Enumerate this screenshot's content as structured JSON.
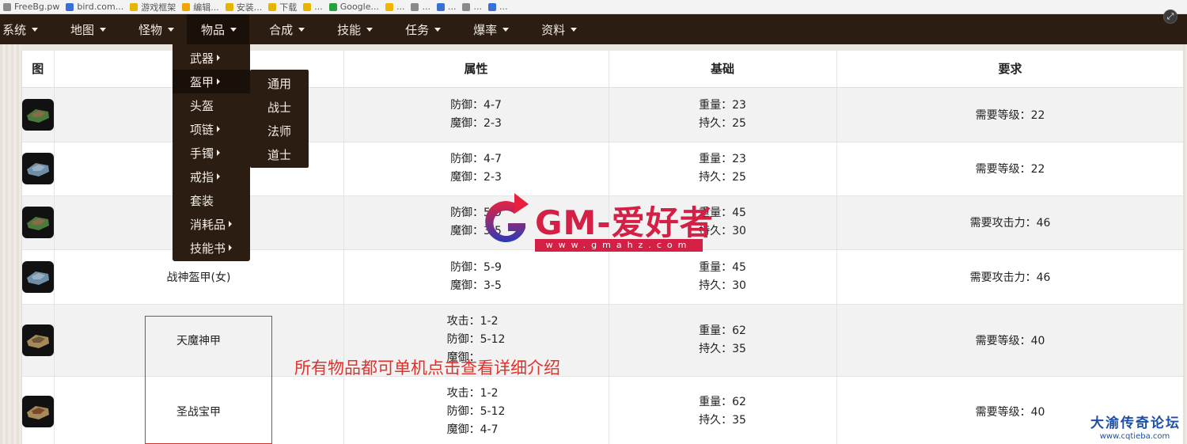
{
  "browser": {
    "bookmarks": [
      {
        "label": "FreeBg.pw",
        "color": "#8a8a8a"
      },
      {
        "label": "bird.com...",
        "color": "#3b6fd8"
      },
      {
        "label": "游戏框架",
        "color": "#e7b400"
      },
      {
        "label": "编辑...",
        "color": "#f0a500"
      },
      {
        "label": "安装...",
        "color": "#e7b400"
      },
      {
        "label": "下载",
        "color": "#e7b400"
      },
      {
        "label": "...",
        "color": "#e7b400"
      },
      {
        "label": "Google...",
        "color": "#22a33b"
      },
      {
        "label": "...",
        "color": "#f2b400"
      },
      {
        "label": "...",
        "color": "#8a8a8a"
      },
      {
        "label": "...",
        "color": "#3b6fd8"
      },
      {
        "label": "...",
        "color": "#8a8a8a"
      },
      {
        "label": "...",
        "color": "#3b6fd8"
      }
    ]
  },
  "nav": {
    "items": [
      {
        "label": "系统"
      },
      {
        "label": "地图"
      },
      {
        "label": "怪物"
      },
      {
        "label": "物品"
      },
      {
        "label": "合成"
      },
      {
        "label": "技能"
      },
      {
        "label": "任务"
      },
      {
        "label": "爆率"
      },
      {
        "label": "资料"
      }
    ],
    "fullscreen_icon": "fullscreen-icon"
  },
  "menu": {
    "items": [
      {
        "label": "武器",
        "has_sub": true
      },
      {
        "label": "盔甲",
        "has_sub": true
      },
      {
        "label": "头盔",
        "has_sub": false
      },
      {
        "label": "项链",
        "has_sub": true
      },
      {
        "label": "手镯",
        "has_sub": true
      },
      {
        "label": "戒指",
        "has_sub": true
      },
      {
        "label": "套装",
        "has_sub": false
      },
      {
        "label": "消耗品",
        "has_sub": true
      },
      {
        "label": "技能书",
        "has_sub": true
      }
    ],
    "submenu": [
      {
        "label": "通用"
      },
      {
        "label": "战士"
      },
      {
        "label": "法师"
      },
      {
        "label": "道士"
      }
    ]
  },
  "table": {
    "headers": {
      "icon": "图",
      "name": "",
      "attr": "属性",
      "base": "基础",
      "req": "要求"
    },
    "rows": [
      {
        "name": "",
        "attr": [
          "防御：4-7",
          "魔御：2-3"
        ],
        "base": [
          "重量：23",
          "持久：25"
        ],
        "req": "需要等级：22"
      },
      {
        "name": "",
        "attr": [
          "防御：4-7",
          "魔御：2-3"
        ],
        "base": [
          "重量：23",
          "持久：25"
        ],
        "req": "需要等级：22"
      },
      {
        "name": "战",
        "attr": [
          "防御：5-9",
          "魔御：3-5"
        ],
        "base": [
          "重量：45",
          "持久：30"
        ],
        "req": "需要攻击力：46"
      },
      {
        "name": "战神盔甲(女)",
        "attr": [
          "防御：5-9",
          "魔御：3-5"
        ],
        "base": [
          "重量：45",
          "持久：30"
        ],
        "req": "需要攻击力：46"
      },
      {
        "name": "天魔神甲",
        "attr": [
          "攻击：1-2",
          "防御：5-12",
          "魔御："
        ],
        "base": [
          "重量：62",
          "持久：35"
        ],
        "req": "需要等级：40"
      },
      {
        "name": "圣战宝甲",
        "attr": [
          "攻击：1-2",
          "防御：5-12",
          "魔御：4-7"
        ],
        "base": [
          "重量：62",
          "持久：35"
        ],
        "req": "需要等级：40"
      }
    ]
  },
  "annotation": {
    "text": "所有物品都可单机点击查看详细介绍"
  },
  "watermark": {
    "brand": "GM-爱好者",
    "url": "www.gmahz.com"
  },
  "forum": {
    "name": "大渝传奇论坛",
    "url": "www.cqtieba.com"
  },
  "colors": {
    "nav_bg": "#2b1d12",
    "accent_red": "#d9302a",
    "brand_red": "#d42044",
    "forum_blue": "#1b4fa8"
  }
}
